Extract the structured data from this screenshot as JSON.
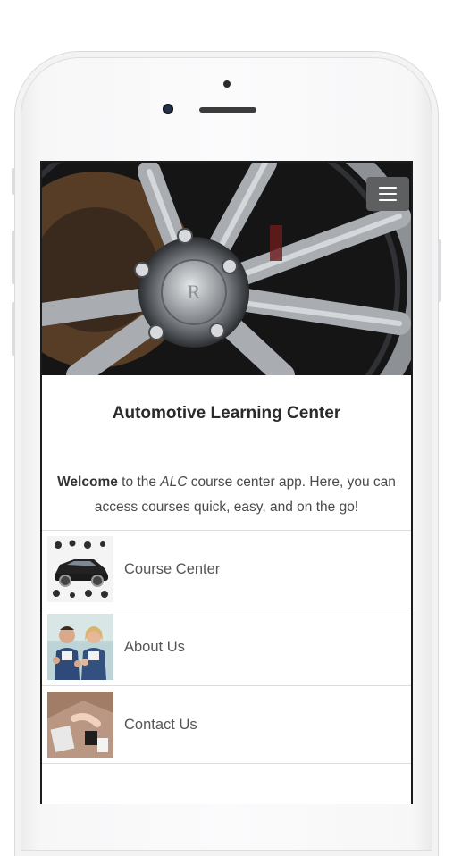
{
  "app": {
    "title": "Automotive Learning Center",
    "intro": {
      "bold": "Welcome",
      "text1": " to the ",
      "italic": "ALC",
      "text2": " course center app. Here, you can access courses quick, easy, and on the go!"
    },
    "menu_icon": "hamburger-icon",
    "list": [
      {
        "label": "Course Center",
        "icon": "car-parts-image"
      },
      {
        "label": "About Us",
        "icon": "mechanics-image"
      },
      {
        "label": "Contact Us",
        "icon": "desk-phone-image"
      }
    ]
  },
  "colors": {
    "menu_button": "#5d5f61",
    "divider": "#dcdcdc",
    "text": "#555555"
  }
}
